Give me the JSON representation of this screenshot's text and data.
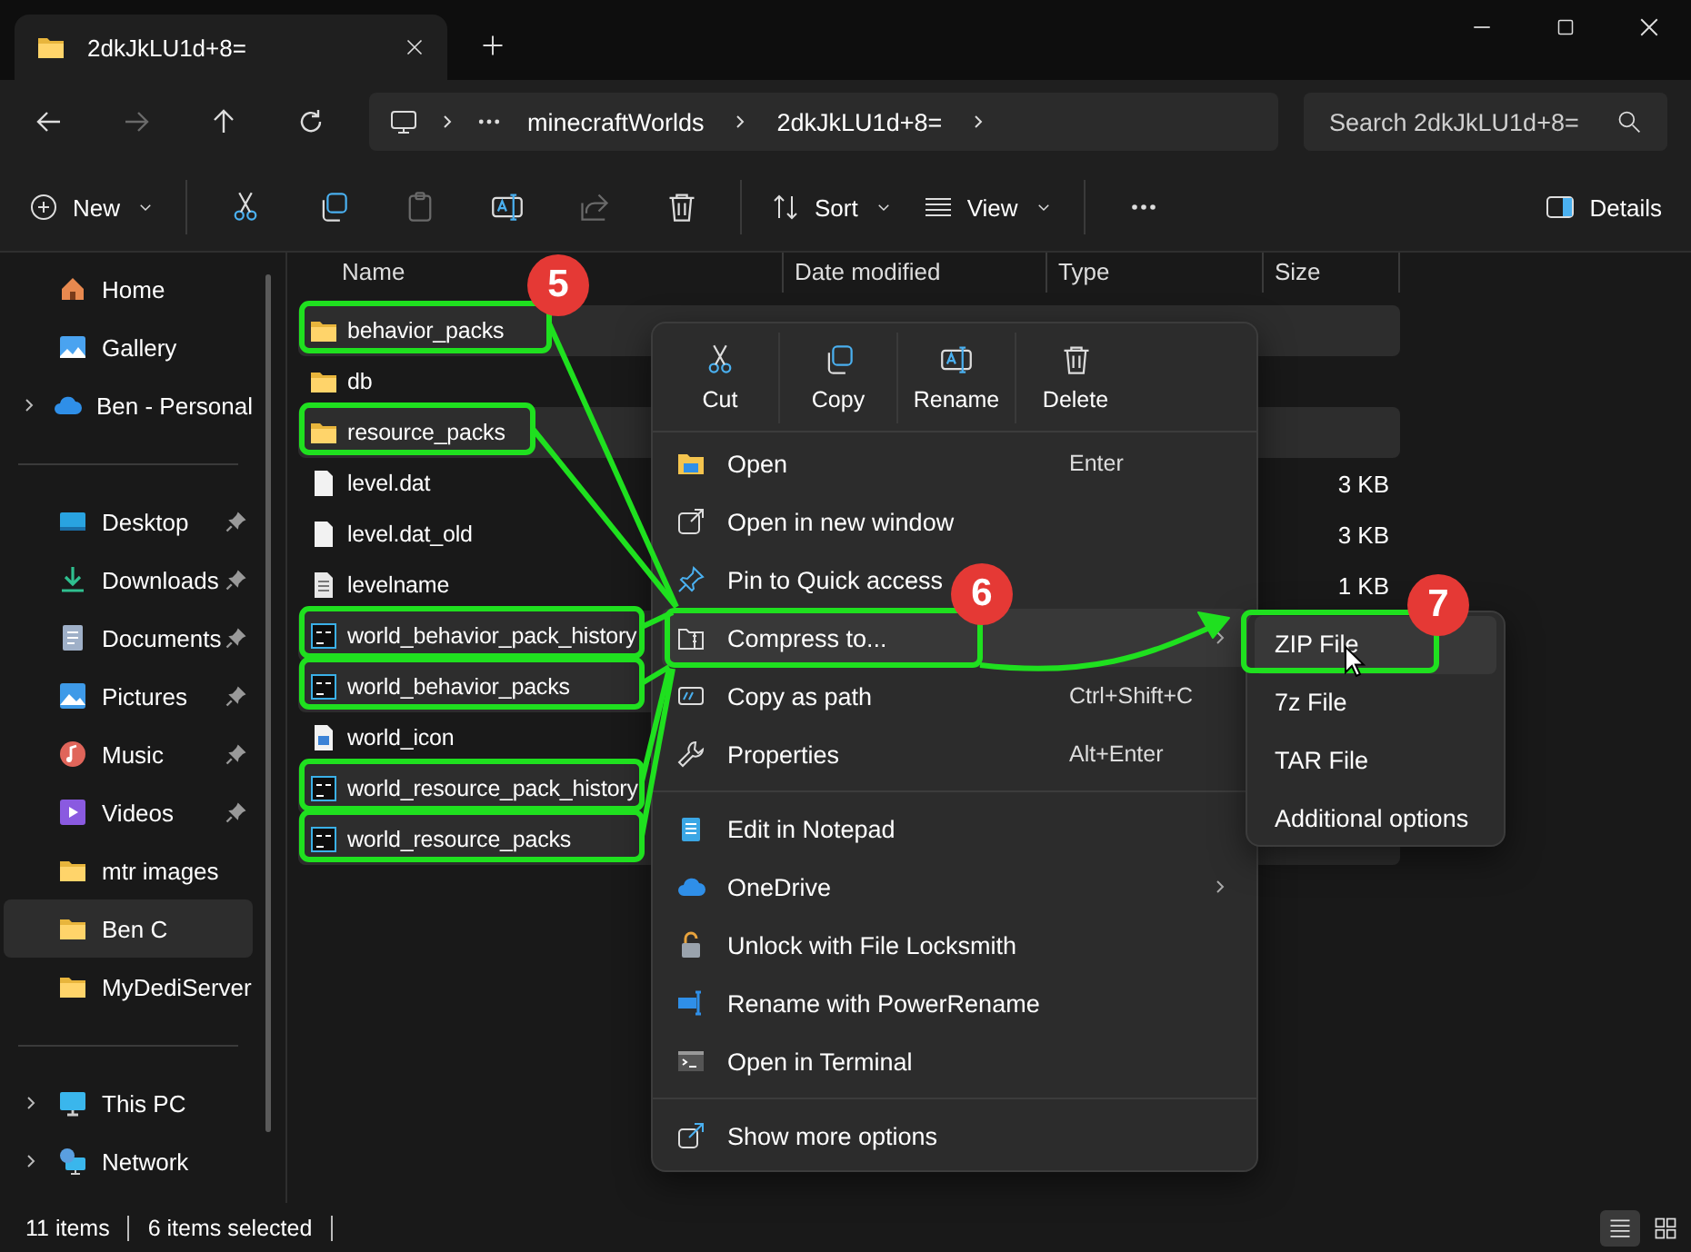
{
  "tab": {
    "title": "2dkJkLU1d+8="
  },
  "nav_buttons": [
    {
      "disabled": false
    },
    {
      "disabled": true
    },
    {
      "disabled": false
    },
    {
      "disabled": false
    }
  ],
  "address": {
    "path": [
      "minecraftWorlds",
      "2dkJkLU1d+8="
    ]
  },
  "search": {
    "placeholder": "Search 2dkJkLU1d+8="
  },
  "toolbar": {
    "new": "New",
    "actions": [
      {
        "disabled": false
      },
      {
        "disabled": false
      },
      {
        "disabled": true
      },
      {
        "disabled": false
      },
      {
        "disabled": true
      },
      {
        "disabled": false
      }
    ],
    "sort": "Sort",
    "view": "View",
    "details": "Details"
  },
  "sidebar": {
    "sections": [
      [
        {
          "label": "Home",
          "expandable": false,
          "pinned": false,
          "selected": false
        },
        {
          "label": "Gallery",
          "expandable": false,
          "pinned": false,
          "selected": false
        },
        {
          "label": "Ben - Personal",
          "expandable": true,
          "pinned": false,
          "selected": false
        }
      ],
      [
        {
          "label": "Desktop",
          "expandable": false,
          "pinned": true,
          "selected": false
        },
        {
          "label": "Downloads",
          "expandable": false,
          "pinned": true,
          "selected": false
        },
        {
          "label": "Documents",
          "expandable": false,
          "pinned": true,
          "selected": false
        },
        {
          "label": "Pictures",
          "expandable": false,
          "pinned": true,
          "selected": false
        },
        {
          "label": "Music",
          "expandable": false,
          "pinned": true,
          "selected": false
        },
        {
          "label": "Videos",
          "expandable": false,
          "pinned": true,
          "selected": false
        },
        {
          "label": "mtr images",
          "expandable": false,
          "pinned": false,
          "selected": false
        },
        {
          "label": "Ben C",
          "expandable": false,
          "pinned": false,
          "selected": true
        },
        {
          "label": "MyDediServer",
          "expandable": false,
          "pinned": false,
          "selected": false
        }
      ],
      [
        {
          "label": "This PC",
          "expandable": true,
          "pinned": false,
          "selected": false
        },
        {
          "label": "Network",
          "expandable": true,
          "pinned": false,
          "selected": false
        }
      ]
    ]
  },
  "files": {
    "columns": [
      "Name",
      "Date modified",
      "Type",
      "Size"
    ],
    "rows": [
      {
        "name": "behavior_packs",
        "kind": "folder",
        "selected": true
      },
      {
        "name": "db",
        "kind": "folder",
        "selected": false
      },
      {
        "name": "resource_packs",
        "kind": "folder",
        "selected": true
      },
      {
        "name": "level.dat",
        "kind": "file",
        "size": "3 KB",
        "selected": false
      },
      {
        "name": "level.dat_old",
        "kind": "file",
        "size": "3 KB",
        "selected": false
      },
      {
        "name": "levelname",
        "kind": "text",
        "size": "1 KB",
        "selected": false
      },
      {
        "name": "world_behavior_pack_history",
        "kind": "script",
        "selected": true
      },
      {
        "name": "world_behavior_packs",
        "kind": "script",
        "selected": true
      },
      {
        "name": "world_icon",
        "kind": "image",
        "selected": false
      },
      {
        "name": "world_resource_pack_history",
        "kind": "script",
        "selected": true
      },
      {
        "name": "world_resource_packs",
        "kind": "script",
        "selected": true
      }
    ]
  },
  "context_menu": {
    "actions": [
      "Cut",
      "Copy",
      "Rename",
      "Delete"
    ],
    "groups": [
      [
        {
          "label": "Open",
          "shortcut": "Enter",
          "has_submenu": false,
          "highlighted": false
        },
        {
          "label": "Open in new window",
          "has_submenu": false,
          "highlighted": false
        },
        {
          "label": "Pin to Quick access",
          "has_submenu": false,
          "highlighted": false
        },
        {
          "label": "Compress to...",
          "has_submenu": true,
          "highlighted": true
        },
        {
          "label": "Copy as path",
          "shortcut": "Ctrl+Shift+C",
          "has_submenu": false,
          "highlighted": false
        },
        {
          "label": "Properties",
          "shortcut": "Alt+Enter",
          "has_submenu": false,
          "highlighted": false
        }
      ],
      [
        {
          "label": "Edit in Notepad",
          "has_submenu": false,
          "highlighted": false
        },
        {
          "label": "OneDrive",
          "has_submenu": true,
          "highlighted": false
        },
        {
          "label": "Unlock with File Locksmith",
          "has_submenu": false,
          "highlighted": false
        },
        {
          "label": "Rename with PowerRename",
          "has_submenu": false,
          "highlighted": false
        },
        {
          "label": "Open in Terminal",
          "has_submenu": false,
          "highlighted": false
        }
      ],
      [
        {
          "label": "Show more options",
          "has_submenu": false,
          "highlighted": false
        }
      ]
    ]
  },
  "submenu": {
    "items": [
      {
        "label": "ZIP File",
        "highlighted": true
      },
      {
        "label": "7z File",
        "highlighted": false
      },
      {
        "label": "TAR File",
        "highlighted": false
      },
      {
        "label": "Additional options",
        "highlighted": false
      }
    ]
  },
  "annotations": {
    "badges": [
      "5",
      "6",
      "7"
    ]
  },
  "status": {
    "count": "11 items",
    "selection": "6 items selected",
    "views": [
      {
        "selected": true
      },
      {
        "selected": false
      }
    ]
  }
}
